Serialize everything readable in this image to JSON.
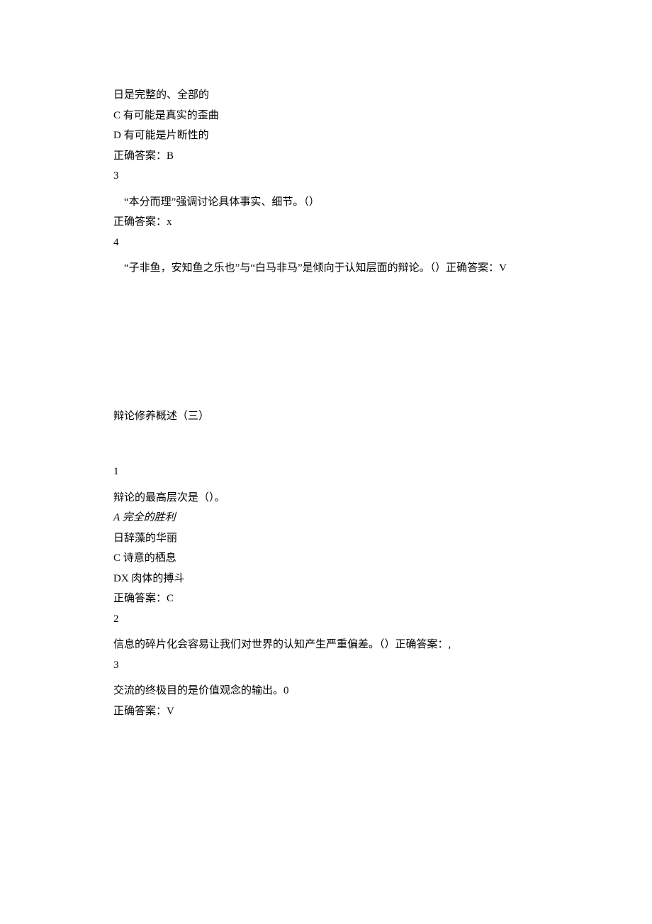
{
  "q_prev": {
    "opt_b": "日是完整的、全部的",
    "opt_c": "C 有可能是真实的歪曲",
    "opt_d": "D 有可能是片断性的",
    "answer": "正确答案：B"
  },
  "q3": {
    "num": "3",
    "text": "“本分而理”强调讨论具体事实、细节。（）",
    "answer": "正确答案：x"
  },
  "q4": {
    "num": "4",
    "text": "“子非鱼，安知鱼之乐也”与“白马非马”是倾向于认知层面的辩论。（）正确答案：V"
  },
  "section": {
    "title": "辩论修养概述（三）"
  },
  "sq1": {
    "num": "1",
    "stem": "辩论的最高层次是（）。",
    "opt_a": "A 完全的胜利",
    "opt_b": "日辞藻的华丽",
    "opt_c": "C 诗意的栖息",
    "opt_d": "DX 肉体的搏斗",
    "answer": "正确答案：C"
  },
  "sq2": {
    "num": "2",
    "text": "信息的碎片化会容易让我们对世界的认知产生严重偏差。（）正确答案：,"
  },
  "sq3": {
    "num": "3",
    "text": "交流的终极目的是价值观念的输出。0",
    "answer": "正确答案：V"
  }
}
